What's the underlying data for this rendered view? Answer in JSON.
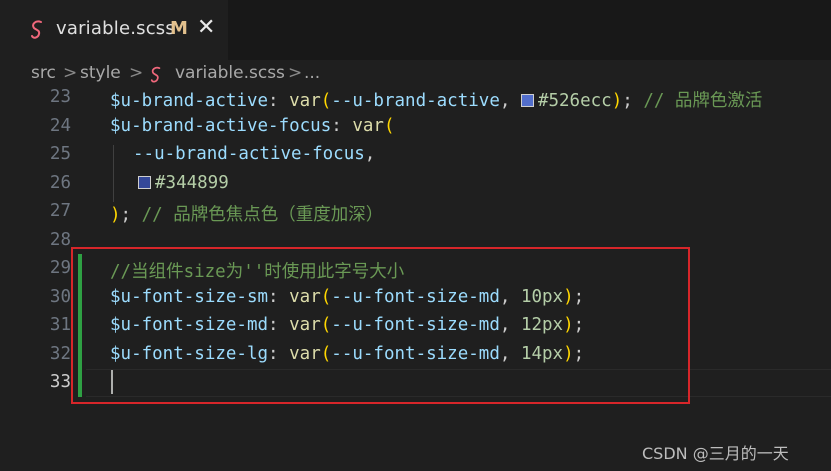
{
  "tab": {
    "filename": "variable.scss",
    "badge": "M",
    "close_glyph": "✕",
    "icon": "sass-icon"
  },
  "breadcrumb": {
    "items": [
      "src",
      "style",
      "variable.scss",
      "..."
    ],
    "separator": ">"
  },
  "editor": {
    "lines": [
      {
        "number": "23"
      },
      {
        "number": "24"
      },
      {
        "number": "25"
      },
      {
        "number": "26"
      },
      {
        "number": "27"
      },
      {
        "number": "28"
      },
      {
        "number": "29"
      },
      {
        "number": "30"
      },
      {
        "number": "31"
      },
      {
        "number": "32"
      },
      {
        "number": "33"
      }
    ],
    "swatch_colors": [
      "#526ecc",
      "#344899"
    ],
    "code": {
      "l23_var": "$u-brand-active",
      "l23_fn": "var",
      "l23_arg": "--u-brand-active",
      "l23_color": "#526ecc",
      "l23_comment": "// 品牌色激活",
      "l24_var": "$u-brand-active-focus",
      "l24_fn": "var",
      "l25_arg": "--u-brand-active-focus",
      "l26_color": "#344899",
      "l27_comment": "// 品牌色焦点色（重度加深）",
      "l29_comment": "//当组件size为''时使用此字号大小",
      "l30_var": "$u-font-size-sm",
      "l30_arg": "--u-font-size-md",
      "l30_num": "10px",
      "l31_var": "$u-font-size-md",
      "l31_arg": "--u-font-size-md",
      "l31_num": "12px",
      "l32_var": "$u-font-size-lg",
      "l32_arg": "--u-font-size-md",
      "l32_num": "14px"
    }
  },
  "watermark": "CSDN @三月的一天"
}
